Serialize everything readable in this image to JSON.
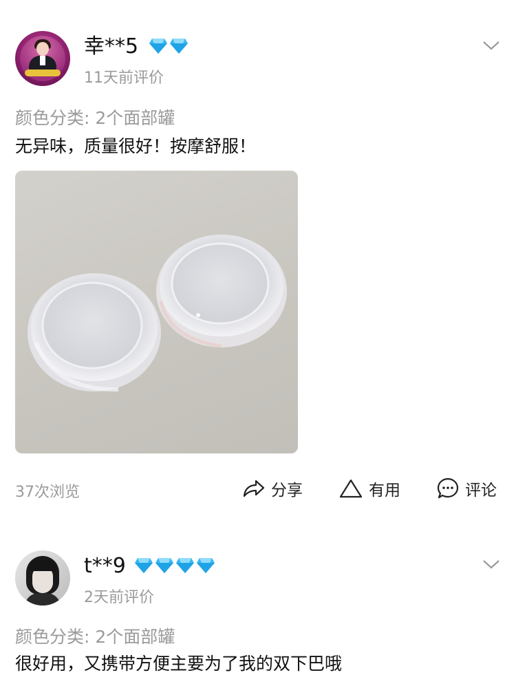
{
  "reviews": [
    {
      "username": "幸**5",
      "vip_diamonds": 2,
      "date": "11天前评价",
      "spec": "颜色分类: 2个面部罐",
      "content": "无异味，质量很好！按摩舒服！",
      "views": "37次浏览",
      "actions": {
        "share": "分享",
        "useful": "有用",
        "comment": "评论"
      }
    },
    {
      "username": "t**9",
      "vip_diamonds": 4,
      "date": "2天前评价",
      "spec": "颜色分类: 2个面部罐",
      "content": "很好用，又携带方便主要为了我的双下巴哦"
    }
  ],
  "colors": {
    "diamond": "#3bb7f0",
    "meta_text": "#9a9a9a",
    "primary_text": "#111111"
  },
  "icons": [
    "chevron-down-icon",
    "diamond-icon",
    "share-icon",
    "thumbs-up-triangle-icon",
    "comment-bubble-icon"
  ]
}
